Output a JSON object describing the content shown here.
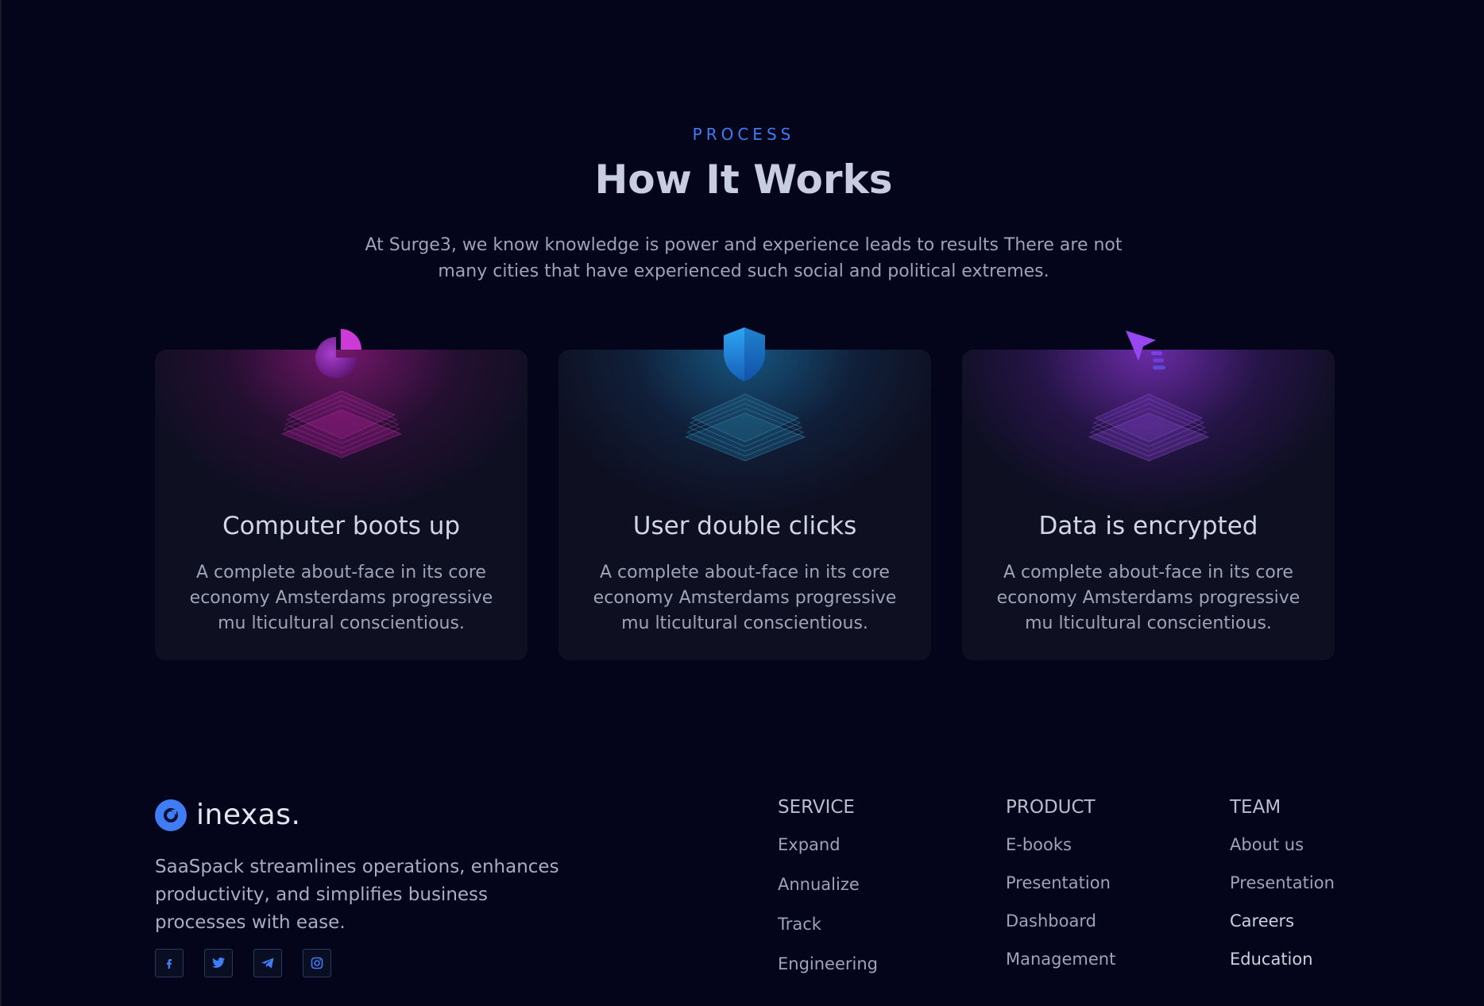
{
  "section": {
    "eyebrow": "PROCESS",
    "title": "How It Works",
    "subtitle": "At Surge3, we know knowledge is power and experience leads to results There are not many cities that have experienced such social and political extremes."
  },
  "cards": [
    {
      "icon": "pie-chart-icon",
      "accent": "#b635d6",
      "title": "Computer boots up",
      "text": "A complete about-face in its core economy Amsterdams progressive mu lticultural conscientious."
    },
    {
      "icon": "shield-icon",
      "accent": "#2a9bf0",
      "title": "User double clicks",
      "text": "A complete about-face in its core economy Amsterdams progressive mu lticultural conscientious."
    },
    {
      "icon": "cursor-icon",
      "accent": "#9a4df0",
      "title": "Data is encrypted",
      "text": "A complete about-face in its core economy Amsterdams progressive mu lticultural conscientious."
    }
  ],
  "footer": {
    "brand_name": "inexas.",
    "description": "SaaSpack streamlines operations, enhances productivity, and simplifies business processes with ease.",
    "socials": [
      "facebook-icon",
      "twitter-icon",
      "telegram-icon",
      "instagram-icon"
    ],
    "columns": [
      {
        "heading": "SERVICE",
        "links": [
          "Expand",
          "Annualize",
          "Track",
          "Engineering"
        ]
      },
      {
        "heading": "PRODUCT",
        "links": [
          "E-books",
          "Presentation",
          "Dashboard",
          "Management"
        ]
      },
      {
        "heading": "TEAM",
        "links": [
          "About us",
          "Presentation",
          "Careers",
          "Education"
        ]
      }
    ]
  },
  "colors": {
    "background": "#04041a",
    "accent_blue": "#3f7cf5",
    "card_bg": "#0e0f21"
  }
}
